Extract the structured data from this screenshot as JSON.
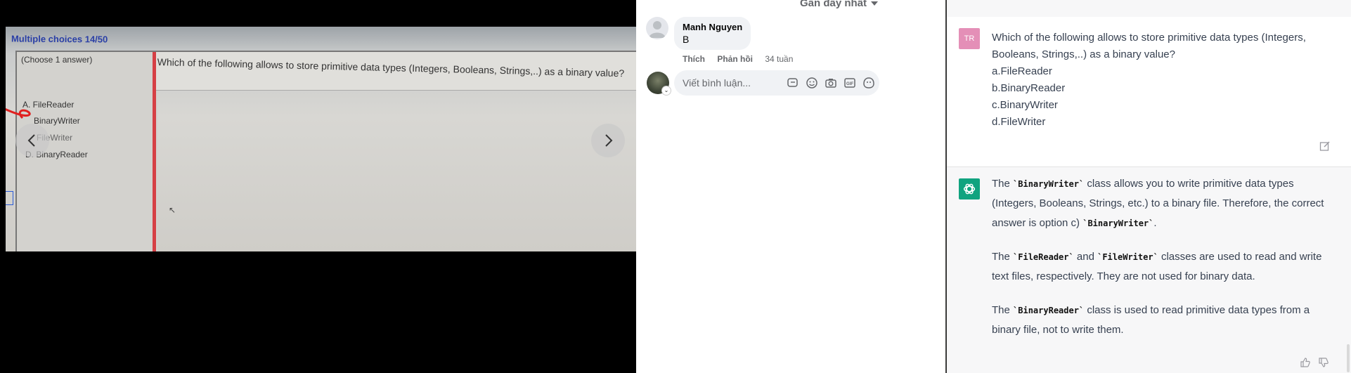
{
  "viewer": {
    "quiz_title": "Multiple choices 14/50",
    "choose_label": "(Choose 1 answer)",
    "question": "Which of the following allows to store primitive data types (Integers, Booleans, Strings,..) as a binary value?",
    "options": [
      "A.  FileReader",
      "BinaryWriter",
      "FileWriter",
      "D.  BinaryReader"
    ],
    "prev_icon": "chevron-left-icon",
    "next_icon": "chevron-right-icon"
  },
  "comments": {
    "sort_label": "Gần đây nhất",
    "items": [
      {
        "author": "Manh Nguyen",
        "text": "B",
        "like_label": "Thích",
        "reply_label": "Phản hồi",
        "time": "34 tuần"
      }
    ],
    "input_placeholder": "Viết bình luận...",
    "input_icons": [
      "sticker-icon",
      "emoji-icon",
      "camera-icon",
      "gif-icon",
      "avatar-sticker-icon"
    ]
  },
  "chat": {
    "user_avatar": "TR",
    "user_message": [
      "Which of the following allows to store primitive data types (Integers, Booleans, Strings,..) as a binary value?",
      "a.FileReader",
      "b.BinaryReader",
      "c.BinaryWriter",
      "d.FileWriter"
    ],
    "assistant_paragraphs": [
      {
        "parts": [
          "The ",
          "`BinaryWriter`",
          " class allows you to write primitive data types (Integers, Booleans, Strings, etc.) to a binary file. Therefore, the correct answer is option c) ",
          "`BinaryWriter`",
          "."
        ]
      },
      {
        "parts": [
          "The ",
          "`FileReader`",
          " and ",
          "`FileWriter`",
          " classes are used to read and write text files, respectively. They are not used for binary data."
        ]
      },
      {
        "parts": [
          "The ",
          "`BinaryReader`",
          " class is used to read primitive data types from a binary file, not to write them."
        ]
      }
    ],
    "colors": {
      "user_avatar_bg": "#e48fb7",
      "assistant_avatar_bg": "#10a37f"
    }
  }
}
